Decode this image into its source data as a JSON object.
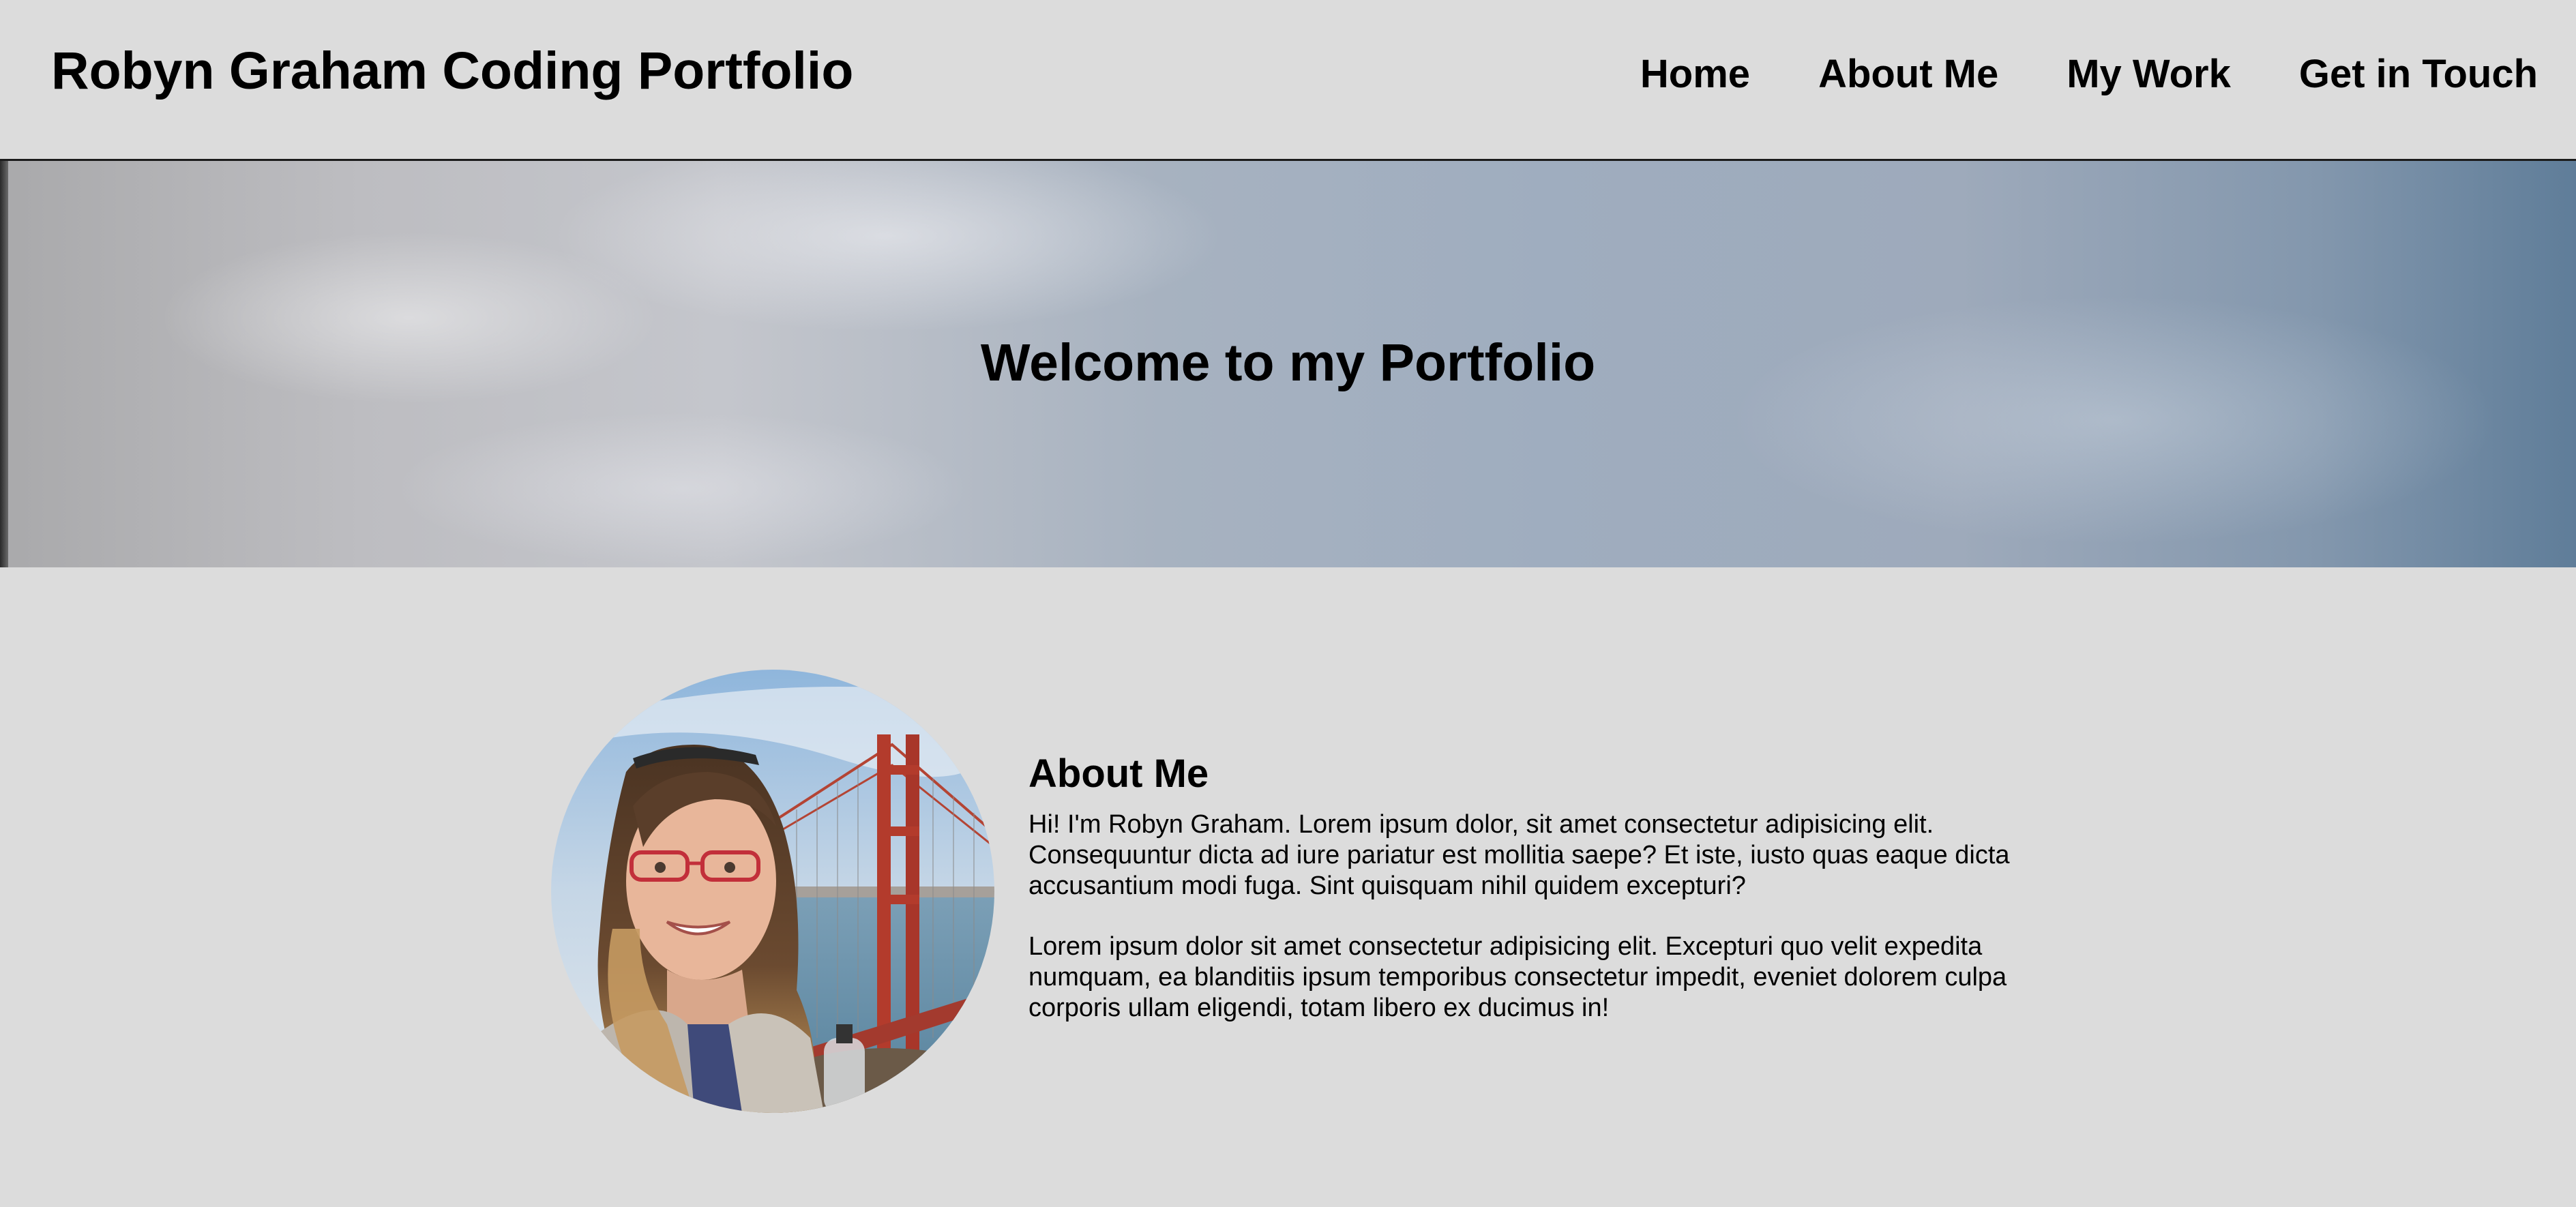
{
  "header": {
    "site_title": "Robyn Graham Coding Portfolio",
    "nav": [
      {
        "label": "Home"
      },
      {
        "label": "About Me"
      },
      {
        "label": "My Work"
      },
      {
        "label": "Get in Touch"
      }
    ]
  },
  "hero": {
    "title": "Welcome to my Portfolio"
  },
  "about": {
    "heading": "About Me",
    "paragraphs": [
      "Hi! I'm Robyn Graham. Lorem ipsum dolor, sit amet consectetur adipisicing elit. Consequuntur dicta ad iure pariatur est mollitia saepe? Et iste, iusto quas eaque dicta accusantium modi fuga. Sint quisquam nihil quidem excepturi?",
      "Lorem ipsum dolor sit amet consectetur adipisicing elit. Excepturi quo velit expedita numquam, ea blanditiis ipsum temporibus consectetur impedit, eveniet dolorem culpa corporis ullam eligendi, totam libero ex ducimus in!"
    ]
  },
  "colors": {
    "page_background": "#dcdcdc",
    "text": "#000000",
    "header_border": "#1b1b1b"
  }
}
